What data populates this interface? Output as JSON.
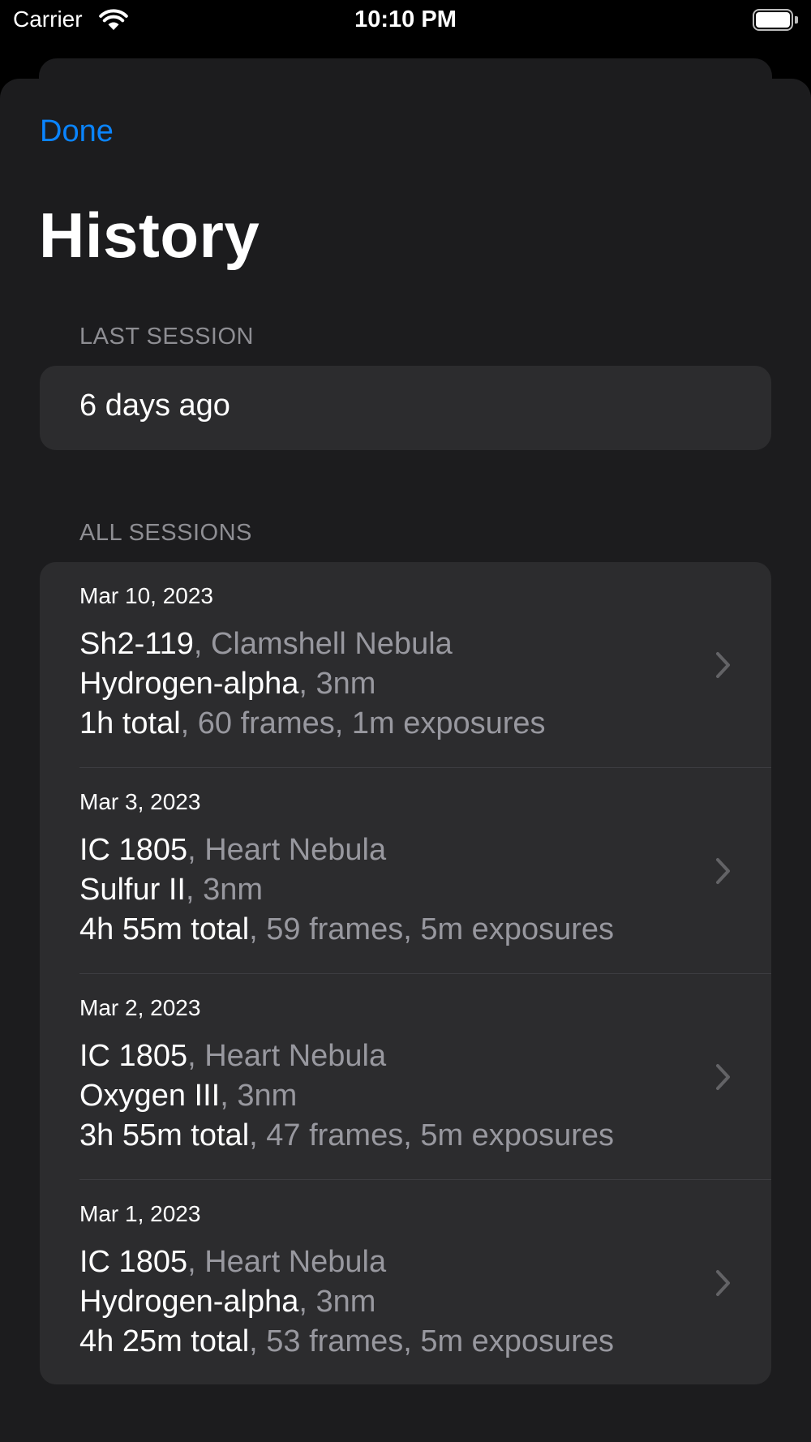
{
  "status_bar": {
    "carrier": "Carrier",
    "time": "10:10 PM"
  },
  "nav": {
    "done_label": "Done",
    "title": "History"
  },
  "last_session": {
    "header": "LAST SESSION",
    "value": "6 days ago"
  },
  "all_sessions": {
    "header": "ALL SESSIONS",
    "items": [
      {
        "date": "Mar 10, 2023",
        "target": "Sh2-119",
        "target_name": ", Clamshell Nebula",
        "filter": "Hydrogen-alpha",
        "filter_width": ", 3nm",
        "total": "1h total",
        "details": ", 60 frames, 1m exposures"
      },
      {
        "date": "Mar 3, 2023",
        "target": "IC 1805",
        "target_name": ", Heart Nebula",
        "filter": "Sulfur II",
        "filter_width": ", 3nm",
        "total": "4h 55m total",
        "details": ", 59 frames, 5m exposures"
      },
      {
        "date": "Mar 2, 2023",
        "target": "IC 1805",
        "target_name": ", Heart Nebula",
        "filter": "Oxygen III",
        "filter_width": ", 3nm",
        "total": "3h 55m total",
        "details": ", 47 frames, 5m exposures"
      },
      {
        "date": "Mar 1, 2023",
        "target": "IC 1805",
        "target_name": ", Heart Nebula",
        "filter": "Hydrogen-alpha",
        "filter_width": ", 3nm",
        "total": "4h 25m total",
        "details": ", 53 frames, 5m exposures"
      }
    ]
  },
  "colors": {
    "accent": "#0a84ff",
    "sheet_background": "#1c1c1e",
    "group_background": "#2c2c2e",
    "secondary_text": "#98989f"
  },
  "icons": {
    "wifi": "wifi-icon",
    "battery": "battery-icon",
    "chevron": "chevron-right-icon"
  }
}
